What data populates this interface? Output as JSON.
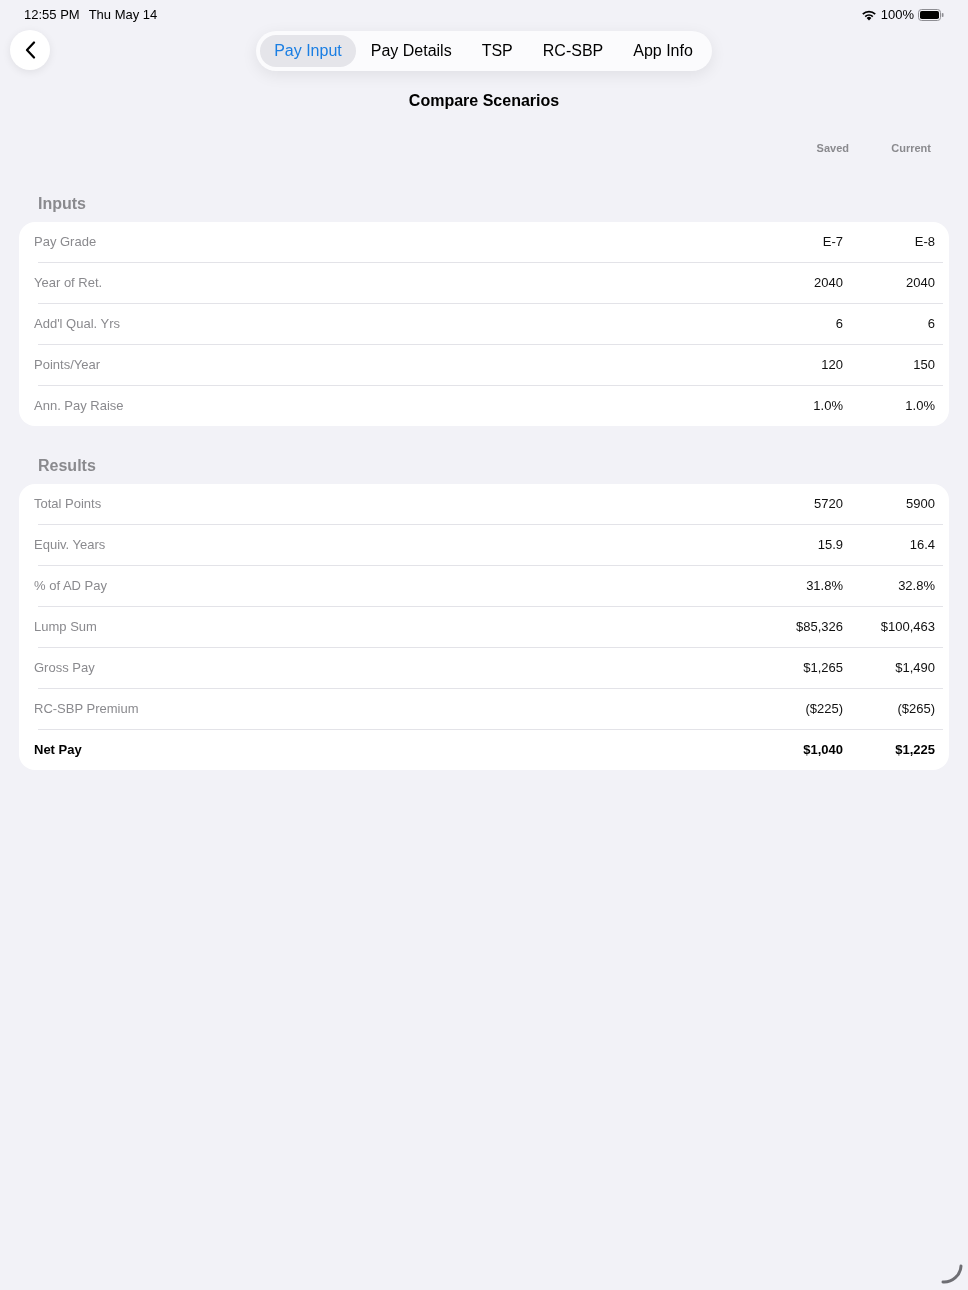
{
  "status_bar": {
    "time": "12:55 PM",
    "date": "Thu May 14",
    "battery": "100%"
  },
  "tabs": [
    {
      "label": "Pay Input",
      "selected": true
    },
    {
      "label": "Pay Details",
      "selected": false
    },
    {
      "label": "TSP",
      "selected": false
    },
    {
      "label": "RC-SBP",
      "selected": false
    },
    {
      "label": "App Info",
      "selected": false
    }
  ],
  "title": "Compare Scenarios",
  "columns": [
    "Saved",
    "Current"
  ],
  "sections": [
    {
      "title": "Inputs",
      "rows": [
        {
          "kind": "item",
          "label": "Pay Grade",
          "values": [
            "E-7",
            "E-8"
          ]
        },
        {
          "kind": "item",
          "label": "Year of Ret.",
          "values": [
            "2040",
            "2040"
          ]
        },
        {
          "kind": "item",
          "label": "Add'l Qual. Yrs",
          "values": [
            "6",
            "6"
          ]
        },
        {
          "kind": "item",
          "label": "Points/Year",
          "values": [
            "120",
            "150"
          ]
        },
        {
          "kind": "item",
          "label": "Ann. Pay Raise",
          "values": [
            "1.0%",
            "1.0%"
          ]
        }
      ]
    },
    {
      "title": "Results",
      "rows": [
        {
          "kind": "item",
          "label": "Total Points",
          "values": [
            "5720",
            "5900"
          ]
        },
        {
          "kind": "item",
          "label": "Equiv. Years",
          "values": [
            "15.9",
            "16.4"
          ]
        },
        {
          "kind": "item",
          "label": "% of AD Pay",
          "values": [
            "31.8%",
            "32.8%"
          ]
        },
        {
          "kind": "item",
          "label": "Lump Sum",
          "values": [
            "$85,326",
            "$100,463"
          ]
        },
        {
          "kind": "item",
          "label": "Gross Pay",
          "values": [
            "$1,265",
            "$1,490"
          ]
        },
        {
          "kind": "item",
          "label": "RC-SBP Premium",
          "values": [
            "($225)",
            "($265)"
          ]
        },
        {
          "kind": "total",
          "label": "Net Pay",
          "values": [
            "$1,040",
            "$1,225"
          ]
        }
      ]
    }
  ]
}
